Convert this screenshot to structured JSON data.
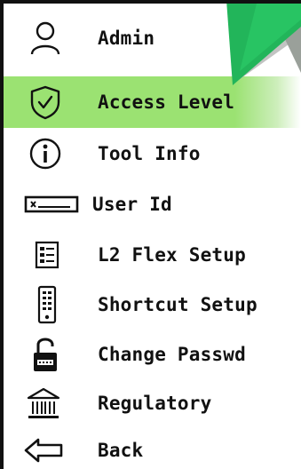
{
  "colors": {
    "selected_bg": "#9be272",
    "pointer_green": "#22b55a",
    "pointer_shadow": "#9aa09a",
    "text": "#111111"
  },
  "menu": {
    "items": [
      {
        "label": "Admin",
        "icon": "user-icon",
        "selected": false
      },
      {
        "label": "Access Level",
        "icon": "shield-check-icon",
        "selected": true
      },
      {
        "label": "Tool Info",
        "icon": "info-icon",
        "selected": false
      },
      {
        "label": "User Id",
        "icon": "id-card-icon",
        "selected": false
      },
      {
        "label": "L2 Flex Setup",
        "icon": "list-settings-icon",
        "selected": false
      },
      {
        "label": "Shortcut Setup",
        "icon": "remote-control-icon",
        "selected": false
      },
      {
        "label": "Change Passwd",
        "icon": "padlock-icon",
        "selected": false
      },
      {
        "label": "Regulatory",
        "icon": "government-building-icon",
        "selected": false
      },
      {
        "label": "Back",
        "icon": "back-arrow-icon",
        "selected": false
      }
    ]
  }
}
